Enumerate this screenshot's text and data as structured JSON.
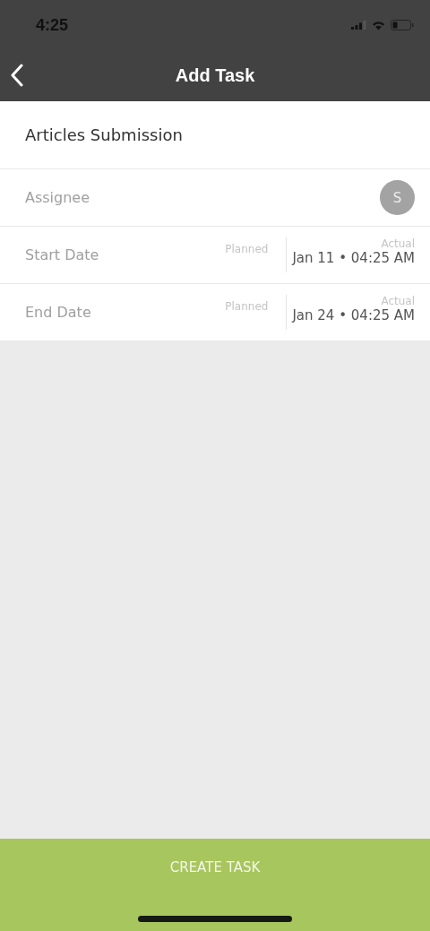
{
  "status_bar": {
    "time": "4:25"
  },
  "header": {
    "title": "Add Task"
  },
  "task_name": {
    "value": "Articles Submission"
  },
  "assignee": {
    "label": "Assignee",
    "avatar": "S"
  },
  "dates": [
    {
      "label": "Start Date",
      "planned_label": "Planned",
      "actual_label": "Actual",
      "actual_value": "Jan 11 • 04:25 AM"
    },
    {
      "label": "End Date",
      "planned_label": "Planned",
      "actual_label": "Actual",
      "actual_value": "Jan 24 • 04:25 AM"
    }
  ],
  "create_button": {
    "label": "CREATE TASK"
  }
}
